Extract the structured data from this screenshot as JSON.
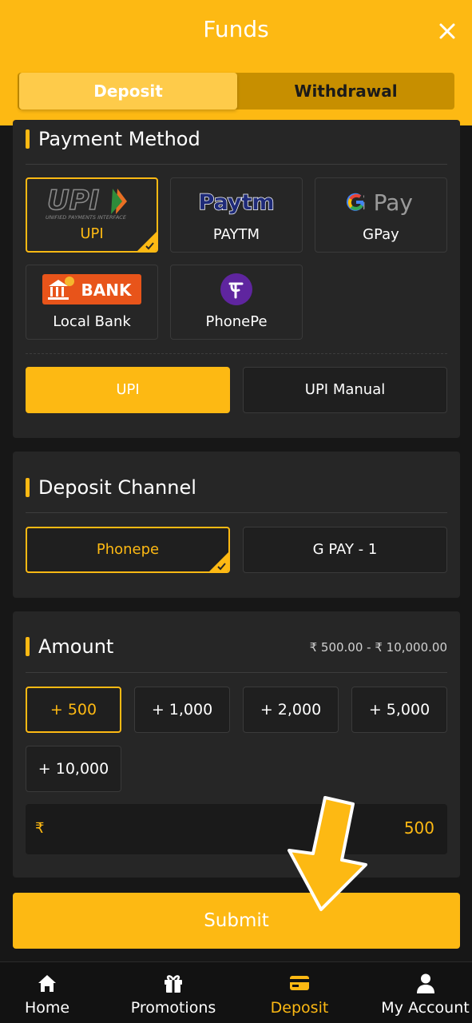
{
  "header": {
    "title": "Funds",
    "tabs": [
      {
        "label": "Deposit",
        "active": true
      },
      {
        "label": "Withdrawal",
        "active": false
      }
    ]
  },
  "payment_method": {
    "title": "Payment Method",
    "methods": [
      {
        "label": "UPI",
        "logo_text": "UPI",
        "logo_subtext": "UNIFIED PAYMENTS INTERFACE",
        "selected": true
      },
      {
        "label": "PAYTM",
        "logo_text": "Paytm",
        "selected": false
      },
      {
        "label": "GPay",
        "logo_text": "G Pay",
        "selected": false
      },
      {
        "label": "Local Bank",
        "logo_text": "BANK",
        "selected": false
      },
      {
        "label": "PhonePe",
        "selected": false
      }
    ],
    "sub_options": [
      {
        "label": "UPI",
        "selected": true
      },
      {
        "label": "UPI Manual",
        "selected": false
      }
    ]
  },
  "deposit_channel": {
    "title": "Deposit Channel",
    "options": [
      {
        "label": "Phonepe",
        "selected": true
      },
      {
        "label": "G PAY - 1",
        "selected": false
      }
    ]
  },
  "amount": {
    "title": "Amount",
    "range": "₹ 500.00 - ₹ 10,000.00",
    "quick_amounts": [
      "+ 500",
      "+ 1,000",
      "+ 2,000",
      "+ 5,000",
      "+ 10,000"
    ],
    "selected_quick": "+ 500",
    "currency_symbol": "₹",
    "value": "500"
  },
  "submit_label": "Submit",
  "nav": [
    {
      "label": "Home",
      "icon": "home-icon",
      "active": false
    },
    {
      "label": "Promotions",
      "icon": "gift-icon",
      "active": false
    },
    {
      "label": "Deposit",
      "icon": "card-icon",
      "active": true
    },
    {
      "label": "My Account",
      "icon": "user-icon",
      "active": false
    }
  ],
  "colors": {
    "accent": "#FDB913",
    "card": "#262626",
    "background": "#171717"
  }
}
